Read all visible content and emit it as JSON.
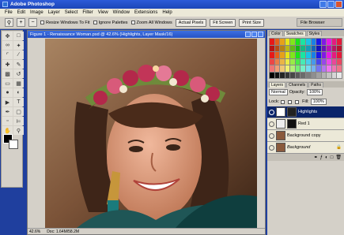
{
  "app": {
    "title": "Adobe Photoshop"
  },
  "menu": [
    "File",
    "Edit",
    "Image",
    "Layer",
    "Select",
    "Filter",
    "View",
    "Window",
    "Extensions",
    "Help"
  ],
  "options": {
    "resize_label": "Resize Windows To Fit",
    "ignore_label": "Ignore Palettes",
    "zoom_all_label": "Zoom All Windows",
    "actual_pixels": "Actual Pixels",
    "fit_screen": "Fit Screen",
    "print_size": "Print Size"
  },
  "file_browser_tab": "File Browser",
  "document": {
    "title": "Figure 1 - Renaissance Woman.psd @ 42.6% (Highlights, Layer Mask/16)",
    "zoom": "42.6%",
    "doc_info": "Doc: 1.64M/58.2M"
  },
  "panels": {
    "top_tabs": [
      "Color",
      "Swatches",
      "Styles"
    ],
    "layer_tabs": [
      "Layers",
      "Channels",
      "Paths"
    ],
    "blend_mode": "Normal",
    "opacity_label": "Opacity:",
    "opacity_value": "100%",
    "lock_label": "Lock:",
    "fill_label": "Fill:",
    "fill_value": "100%"
  },
  "layers": [
    {
      "name": "Highlights",
      "selected": true
    },
    {
      "name": "Red 1",
      "selected": false
    },
    {
      "name": "Background copy",
      "selected": false
    },
    {
      "name": "Background",
      "selected": false
    }
  ],
  "colors": {
    "xp_blue": "#1f3f9e",
    "panel_gray": "#d4d0c8",
    "selection": "#0a246a"
  }
}
